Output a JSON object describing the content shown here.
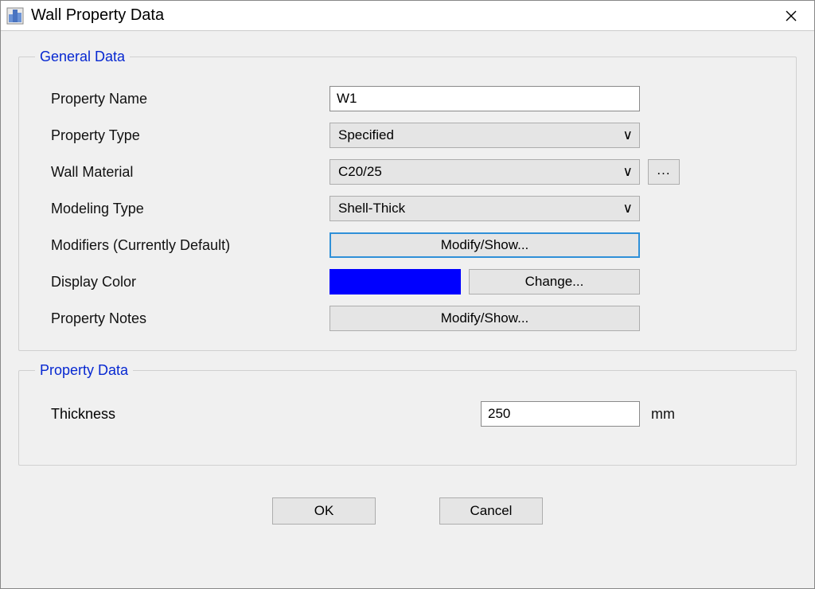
{
  "window": {
    "title": "Wall Property Data"
  },
  "general": {
    "legend": "General Data",
    "property_name_label": "Property Name",
    "property_name_value": "W1",
    "property_type_label": "Property Type",
    "property_type_value": "Specified",
    "wall_material_label": "Wall Material",
    "wall_material_value": "C20/25",
    "wall_material_more": "...",
    "modeling_type_label": "Modeling Type",
    "modeling_type_value": "Shell-Thick",
    "modifiers_label": "Modifiers (Currently Default)",
    "modifiers_button": "Modify/Show...",
    "display_color_label": "Display Color",
    "display_color_hex": "#0000FF",
    "change_button": "Change...",
    "property_notes_label": "Property Notes",
    "property_notes_button": "Modify/Show..."
  },
  "property_data": {
    "legend": "Property Data",
    "thickness_label": "Thickness",
    "thickness_value": "250",
    "thickness_unit": "mm"
  },
  "actions": {
    "ok": "OK",
    "cancel": "Cancel"
  }
}
